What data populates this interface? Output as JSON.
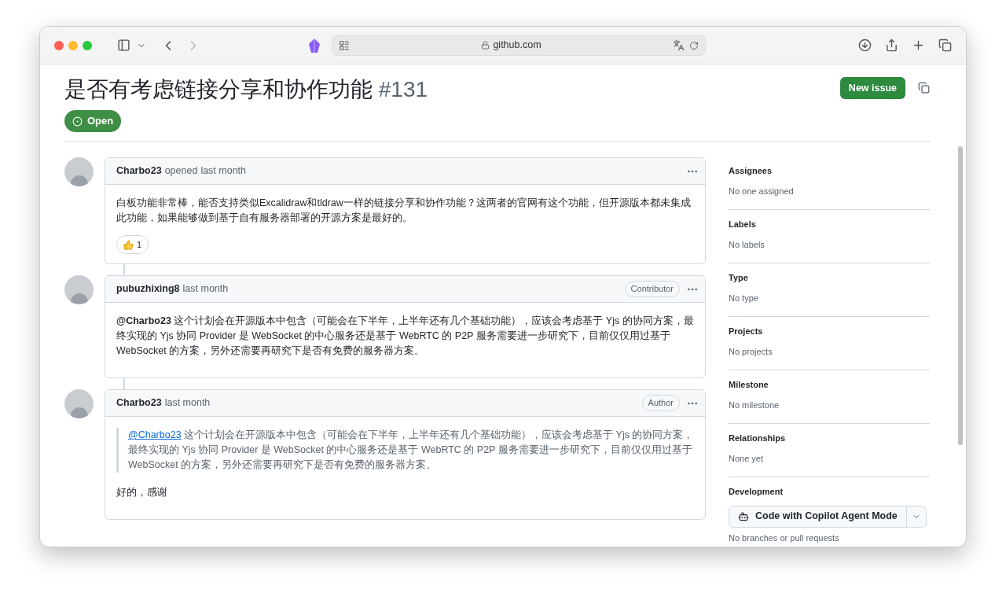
{
  "browser": {
    "address": "github.com"
  },
  "issue": {
    "title": "是否有考虑链接分享和协作功能",
    "number": "#131",
    "status": "Open",
    "new_issue_button": "New issue"
  },
  "comments": [
    {
      "author": "Charbo23",
      "action": "opened",
      "time": "last month",
      "body": [
        {
          "kind": "paragraph",
          "text": "白板功能非常棒，能否支持类似Excalidraw和tldraw一样的链接分享和协作功能？这两者的官网有这个功能，但开源版本都未集成此功能，如果能够做到基于自有服务器部署的开源方案是最好的。"
        }
      ],
      "reactions": [
        {
          "kind": "thumbs_up",
          "count": "1"
        }
      ]
    },
    {
      "author": "pubuzhixing8",
      "time": "last month",
      "badge": "Contributor",
      "body": [
        {
          "kind": "paragraph",
          "mention": "@Charbo23",
          "text": " 这个计划会在开源版本中包含（可能会在下半年，上半年还有几个基础功能），应该会考虑基于 Yjs 的协同方案，最终实现的 Yjs 协同 Provider 是 WebSocket 的中心服务还是基于 WebRTC 的 P2P 服务需要进一步研究下，目前仅仅用过基于 WebSocket 的方案，另外还需要再研究下是否有免费的服务器方案。"
        }
      ]
    },
    {
      "author": "Charbo23",
      "time": "last month",
      "badge": "Author",
      "body": [
        {
          "kind": "quote",
          "mention": "@Charbo23",
          "text": " 这个计划会在开源版本中包含（可能会在下半年，上半年还有几个基础功能），应该会考虑基于 Yjs 的协同方案，最终实现的 Yjs 协同 Provider 是 WebSocket 的中心服务还是基于 WebRTC 的 P2P 服务需要进一步研究下，目前仅仅用过基于 WebSocket 的方案，另外还需要再研究下是否有免费的服务器方案。"
        },
        {
          "kind": "paragraph",
          "text": "好的，感谢"
        }
      ]
    }
  ],
  "sidebar": {
    "sections": [
      {
        "heading": "Assignees",
        "value": "No one assigned"
      },
      {
        "heading": "Labels",
        "value": "No labels"
      },
      {
        "heading": "Type",
        "value": "No type"
      },
      {
        "heading": "Projects",
        "value": "No projects"
      },
      {
        "heading": "Milestone",
        "value": "No milestone"
      },
      {
        "heading": "Relationships",
        "value": "None yet"
      }
    ],
    "development": {
      "heading": "Development",
      "button": "Code with Copilot Agent Mode",
      "value": "No branches or pull requests"
    }
  }
}
